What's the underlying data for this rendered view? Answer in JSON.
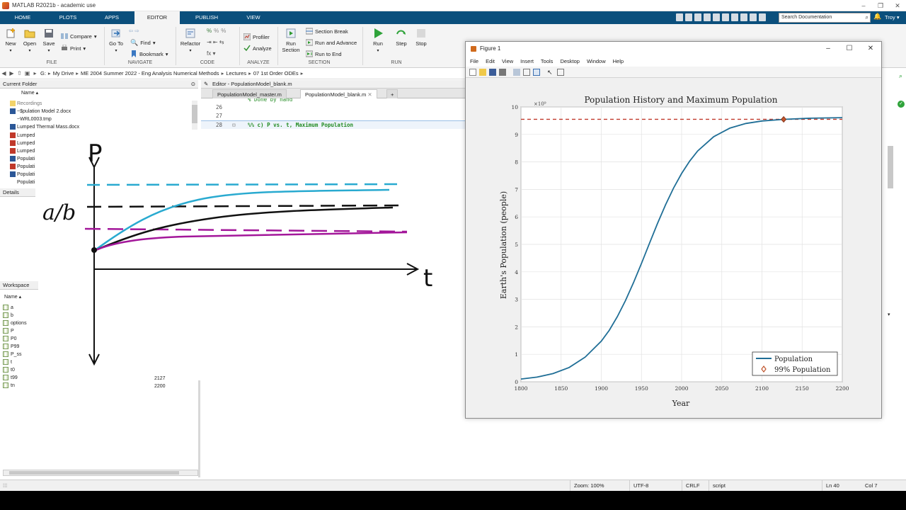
{
  "window": {
    "title": "MATLAB R2021b - academic use"
  },
  "tabs": [
    {
      "label": "HOME",
      "active": false
    },
    {
      "label": "PLOTS",
      "active": false
    },
    {
      "label": "APPS",
      "active": false
    },
    {
      "label": "EDITOR",
      "active": true
    },
    {
      "label": "PUBLISH",
      "active": false
    },
    {
      "label": "VIEW",
      "active": false
    }
  ],
  "search": {
    "placeholder": "Search Documentation"
  },
  "user": "Troy",
  "toolstrip": {
    "file": {
      "new": "New",
      "open": "Open",
      "save": "Save",
      "compare": "Compare",
      "print": "Print",
      "group": "FILE"
    },
    "navigate": {
      "goto": "Go To",
      "find": "Find",
      "bookmark": "Bookmark",
      "group": "NAVIGATE"
    },
    "code": {
      "refactor": "Refactor",
      "group": "CODE"
    },
    "analyze": {
      "profiler": "Profiler",
      "analyze": "Analyze",
      "group": "ANALYZE"
    },
    "section": {
      "run_section": "Run Section",
      "section_break": "Section Break",
      "run_and_advance": "Run and Advance",
      "run_to_end": "Run to End",
      "group": "SECTION"
    },
    "run": {
      "run": "Run",
      "step": "Step",
      "stop": "Stop",
      "group": "RUN"
    }
  },
  "address": [
    "G:",
    "My Drive",
    "ME 2004 Summer 2022 - Eng Analysis Numerical Methods",
    "Lectures",
    "07 1st Order ODEs"
  ],
  "current_folder": {
    "title": "Current Folder",
    "name_col": "Name ▴",
    "items": [
      "Recordings",
      "~$pulation Model 2.docx",
      "~WRL0003.tmp",
      "Lumped Thermal Mass.docx",
      "Lumped",
      "Lumped",
      "Lumped",
      "Populati",
      "Populati",
      "Populati",
      "Populati"
    ]
  },
  "details": {
    "title": "Details"
  },
  "workspace": {
    "title": "Workspace",
    "name_col": "Name ▴",
    "vars": [
      "a",
      "b",
      "options",
      "P",
      "P0",
      "P99",
      "P_ss",
      "t",
      "t0",
      "t99",
      "tn"
    ],
    "visible_values": {
      "t99": "2127",
      "tn": "2200"
    }
  },
  "editor": {
    "title": "Editor - PopulationModel_blank.m",
    "tabs": [
      "PopulationModel_master.m",
      "PopulationModel_blank.m"
    ],
    "add_tab": "+",
    "lines": [
      {
        "n": "26",
        "code": ""
      },
      {
        "n": "27",
        "code": ""
      },
      {
        "n": "28",
        "code": "%% c) P vs. t, Maximum Population"
      }
    ],
    "partial_line": "% Done by hand"
  },
  "figure": {
    "title": "Figure 1",
    "menu": [
      "File",
      "Edit",
      "View",
      "Insert",
      "Tools",
      "Desktop",
      "Window",
      "Help"
    ]
  },
  "chart_data": {
    "type": "line",
    "title": "Population History and Maximum Population",
    "xlabel": "Year",
    "ylabel": "Earth's Population (people)",
    "y_exponent_label": "×10⁹",
    "xlim": [
      1800,
      2200
    ],
    "ylim": [
      0,
      10
    ],
    "xticks": [
      1800,
      1850,
      1900,
      1950,
      2000,
      2050,
      2100,
      2150,
      2200
    ],
    "yticks": [
      0,
      1,
      2,
      3,
      4,
      5,
      6,
      7,
      8,
      9,
      10
    ],
    "grid": true,
    "legend_position": "bottom-right",
    "series": [
      {
        "name": "Population",
        "color": "#1f6e96",
        "x": [
          1800,
          1820,
          1840,
          1860,
          1880,
          1900,
          1910,
          1920,
          1930,
          1940,
          1950,
          1960,
          1970,
          1980,
          1990,
          2000,
          2010,
          2020,
          2040,
          2060,
          2080,
          2100,
          2127,
          2160,
          2200
        ],
        "y": [
          0.1,
          0.17,
          0.3,
          0.52,
          0.9,
          1.48,
          1.88,
          2.37,
          2.95,
          3.6,
          4.31,
          5.04,
          5.76,
          6.44,
          7.05,
          7.58,
          8.03,
          8.4,
          8.92,
          9.23,
          9.4,
          9.49,
          9.55,
          9.59,
          9.61
        ]
      },
      {
        "name": "99% Population",
        "color": "#c0562e",
        "marker": "diamond",
        "x": [
          2127
        ],
        "y": [
          9.55
        ]
      }
    ],
    "reference_line": {
      "y": 9.55,
      "style": "dashed",
      "color": "#c0392b"
    }
  },
  "sketch": {
    "y_axis_label": "P",
    "x_axis_label": "t",
    "asymptote_label": "a/b"
  },
  "status": {
    "zoom": "Zoom: 100%",
    "encoding": "UTF-8",
    "eol": "CRLF",
    "type": "script",
    "ln": "Ln 40",
    "col": "Col 7"
  },
  "colors": {
    "tabstrip": "#0b4f7c",
    "sketch_cyan": "#29aad0",
    "sketch_black": "#111111",
    "sketch_magenta": "#a3179a"
  }
}
